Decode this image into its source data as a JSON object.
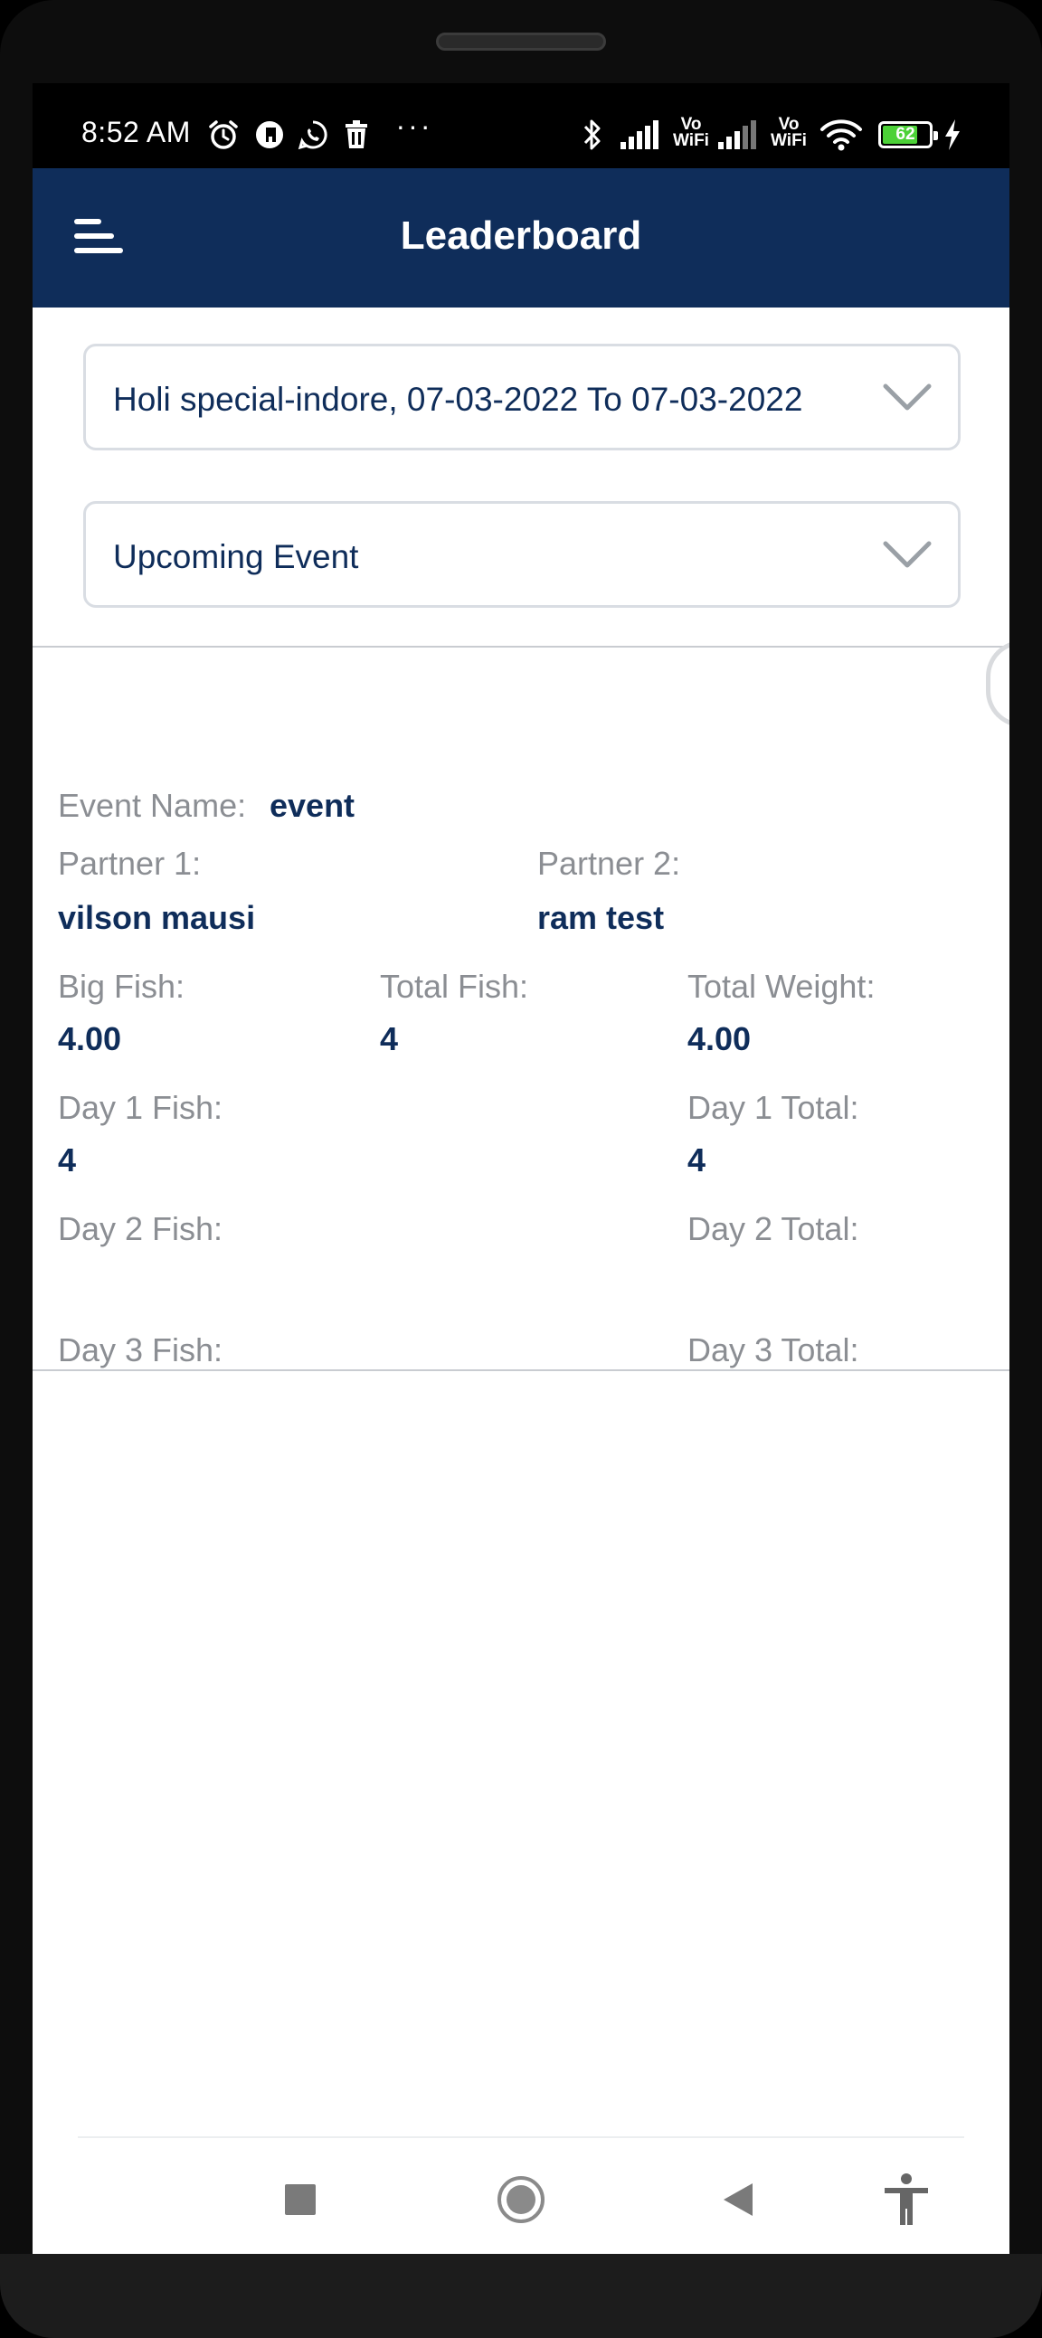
{
  "status_bar": {
    "time": "8:52 AM",
    "more": "···",
    "volte_1_top": "Vo",
    "volte_1_bottom": "WiFi",
    "volte_2_top": "Vo",
    "volte_2_bottom": "WiFi",
    "battery_level": "62",
    "icons": [
      "alarm-icon",
      "p-app-icon",
      "whatsapp-icon",
      "trash-icon",
      "bluetooth-icon",
      "signal-icon",
      "wifi-icon",
      "battery-icon",
      "charging-icon"
    ]
  },
  "app_bar": {
    "title": "Leaderboard"
  },
  "filters": {
    "tournament": "Holi special-indore, 07-03-2022  To  07-03-2022",
    "event_type": "Upcoming Event"
  },
  "event": {
    "event_name_label": "Event Name:",
    "event_name": "event",
    "partner1_label": "Partner 1:",
    "partner1": "vilson mausi",
    "partner2_label": "Partner 2:",
    "partner2": "ram test",
    "big_fish_label": "Big Fish:",
    "big_fish": "4.00",
    "total_fish_label": "Total Fish:",
    "total_fish": "4",
    "total_weight_label": "Total Weight:",
    "total_weight": "4.00",
    "day1_fish_label": "Day 1 Fish:",
    "day1_fish": "4",
    "day1_total_label": "Day 1 Total:",
    "day1_total": "4",
    "day2_fish_label": "Day 2 Fish:",
    "day2_fish": "",
    "day2_total_label": "Day 2 Total:",
    "day2_total": "",
    "day3_fish_label": "Day 3 Fish:",
    "day3_fish": "",
    "day3_total_label": "Day 3 Total:",
    "day3_total": ""
  },
  "colors": {
    "primary": "#0f2d5a",
    "label": "#8b8e93",
    "border": "#d9dde3"
  },
  "nav_bar": {
    "icons": [
      "recent-apps-icon",
      "home-icon",
      "back-icon",
      "accessibility-icon"
    ]
  }
}
